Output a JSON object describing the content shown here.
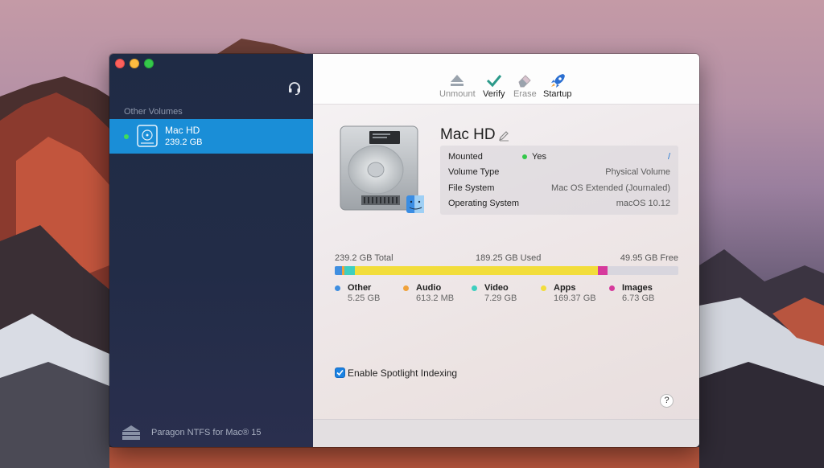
{
  "app": {
    "brand": "Paragon NTFS for Mac® 15"
  },
  "sidebar": {
    "section_header": "Other Volumes",
    "volume": {
      "name": "Mac HD",
      "size": "239.2 GB",
      "status_color": "#3edc5b"
    }
  },
  "toolbar": {
    "unmount": "Unmount",
    "verify": "Verify",
    "erase": "Erase",
    "startup": "Startup"
  },
  "volume_info": {
    "title": "Mac HD",
    "rows": [
      {
        "label": "Mounted",
        "value": "Yes",
        "action": "/"
      },
      {
        "label": "Volume Type",
        "value": "Physical Volume"
      },
      {
        "label": "File System",
        "value": "Mac OS Extended (Journaled)"
      },
      {
        "label": "Operating System",
        "value": "macOS 10.12"
      }
    ]
  },
  "usage": {
    "total": "239.2 GB Total",
    "used": "189.25 GB Used",
    "free": "49.95 GB Free",
    "categories": [
      {
        "name": "Other",
        "value": "5.25 GB",
        "gb": 5.25,
        "color": "#3f8ee0"
      },
      {
        "name": "Audio",
        "value": "613.2 MB",
        "gb": 0.6132,
        "color": "#f0a23a"
      },
      {
        "name": "Video",
        "value": "7.29 GB",
        "gb": 7.29,
        "color": "#3ecfbf"
      },
      {
        "name": "Apps",
        "value": "169.37 GB",
        "gb": 169.37,
        "color": "#f2dd3b"
      },
      {
        "name": "Images",
        "value": "6.73 GB",
        "gb": 6.73,
        "color": "#d63a9c"
      }
    ],
    "total_gb": 239.2
  },
  "options": {
    "spotlight_label": "Enable Spotlight Indexing",
    "spotlight_checked": true
  },
  "help": "?"
}
